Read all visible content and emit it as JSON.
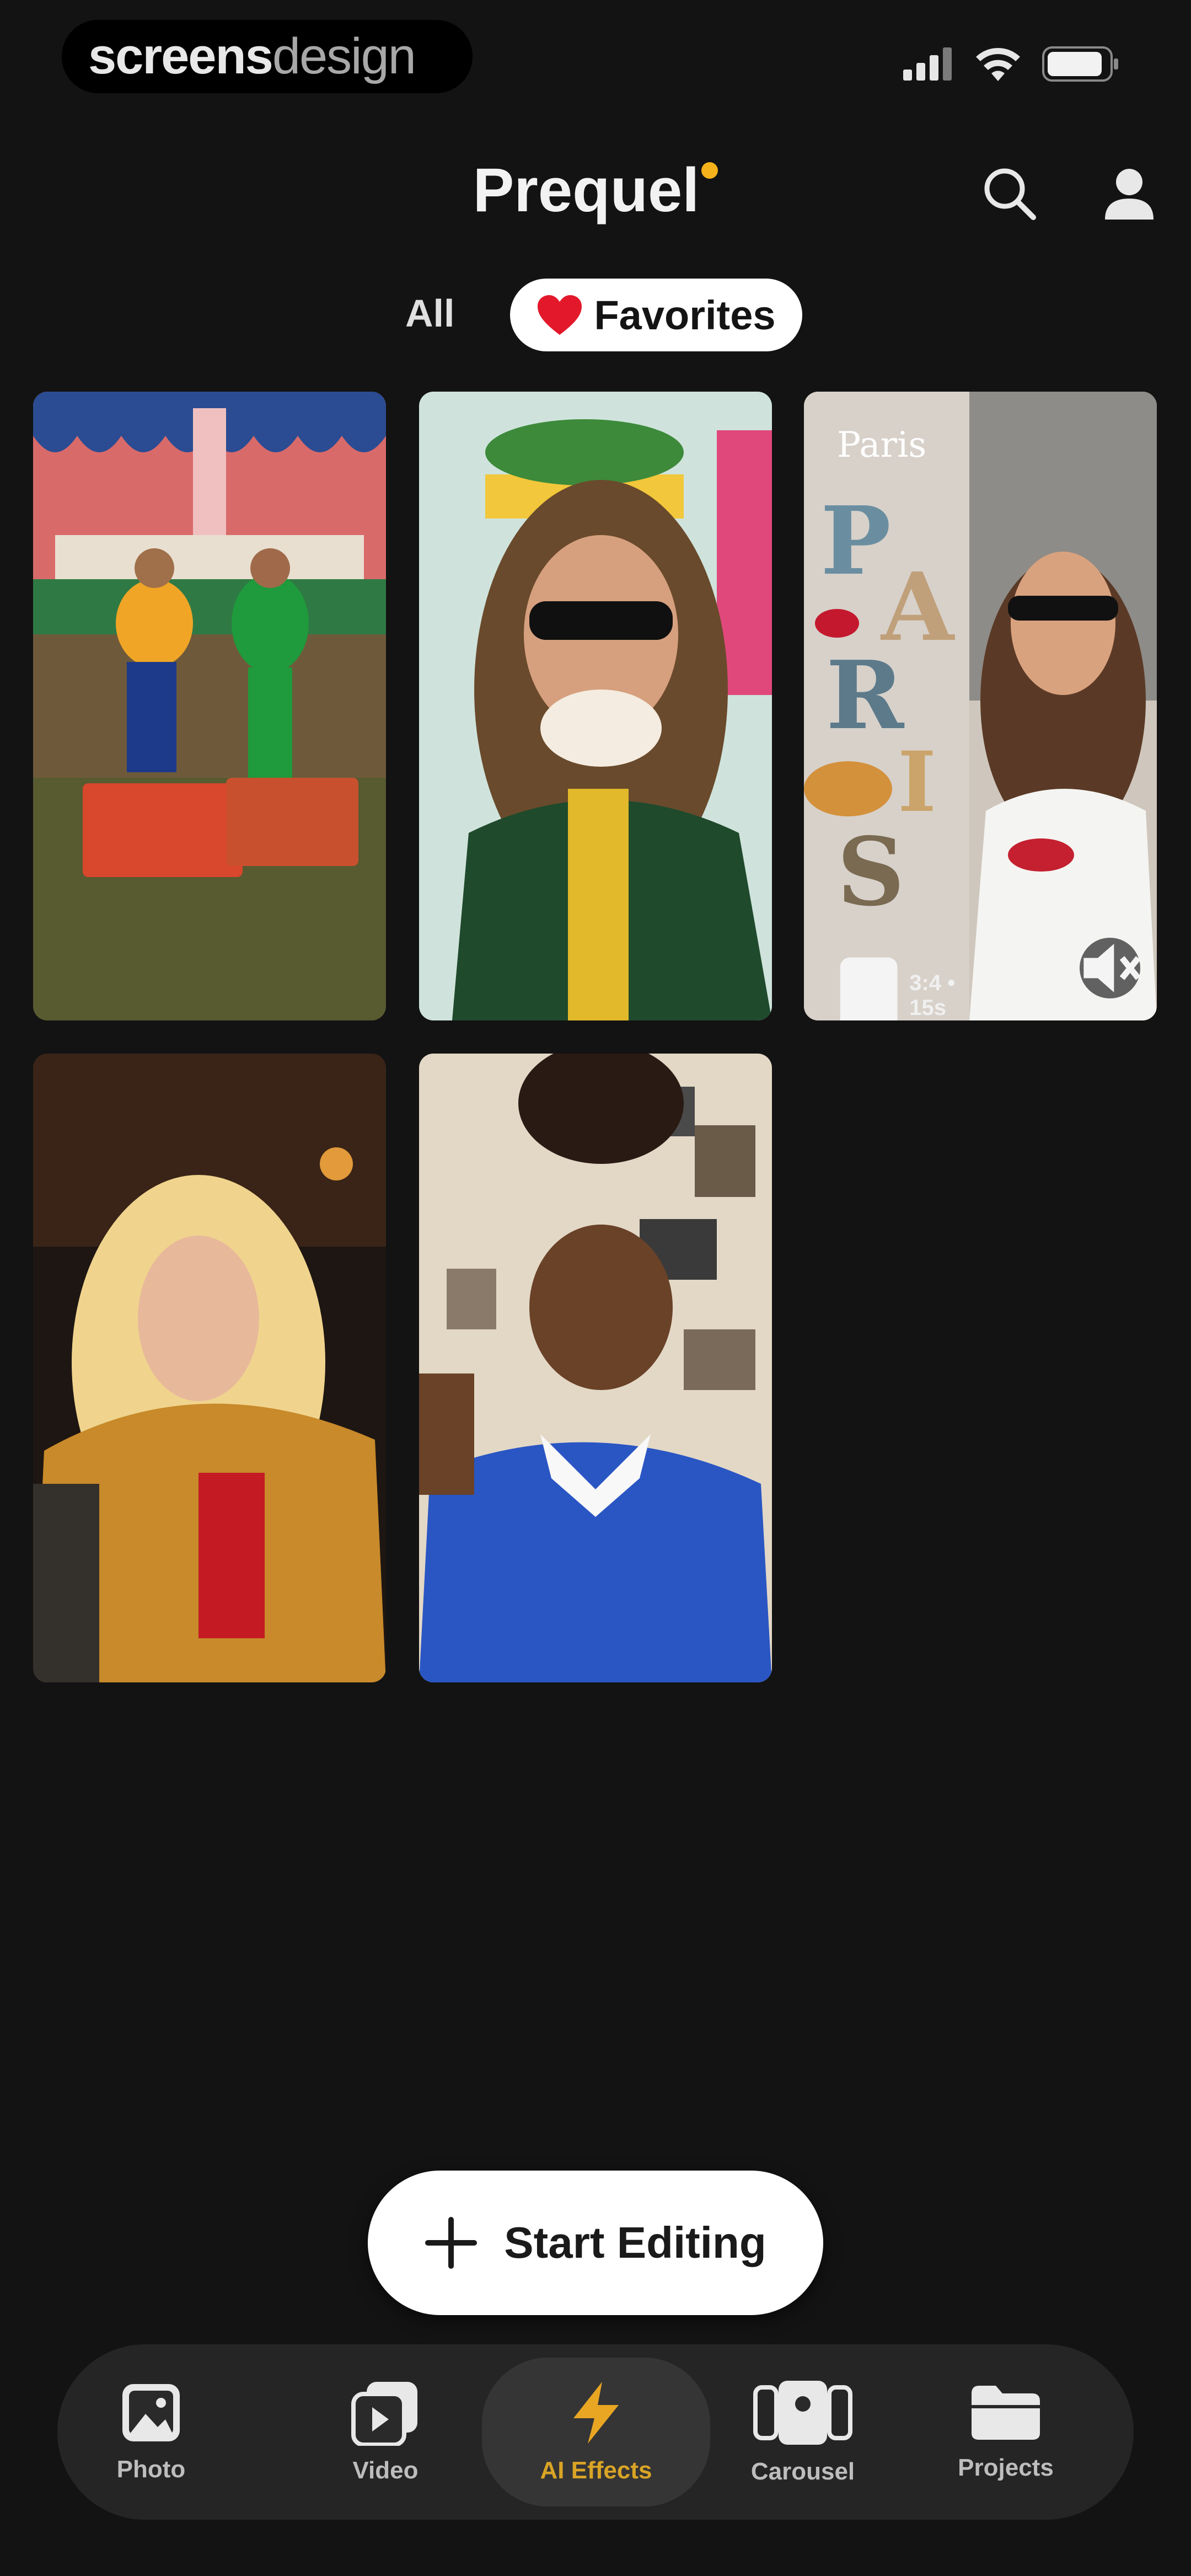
{
  "status_bar": {
    "brand_bold": "screens",
    "brand_light": "design"
  },
  "header": {
    "title": "Prequel",
    "accent_color": "#f5b21a"
  },
  "tabs": {
    "all_label": "All",
    "favorites_label": "Favorites",
    "favorites_icon": "heart-icon"
  },
  "grid": {
    "items": [
      {
        "kind": "photo"
      },
      {
        "kind": "photo"
      },
      {
        "kind": "video",
        "overlay_title": "Paris",
        "overlay_meta": "3:4 • 15s",
        "sound_icon": "mute-icon"
      },
      {
        "kind": "photo"
      },
      {
        "kind": "photo"
      }
    ]
  },
  "cta": {
    "label": "Start Editing",
    "icon": "plus-icon"
  },
  "bottom_nav": {
    "active_color": "#d9a426",
    "items": [
      {
        "label": "Photo",
        "icon": "photo-icon"
      },
      {
        "label": "Video",
        "icon": "video-icon"
      },
      {
        "label": "AI Effects",
        "icon": "lightning-icon",
        "active": true
      },
      {
        "label": "Carousel",
        "icon": "carousel-icon"
      },
      {
        "label": "Projects",
        "icon": "folder-icon"
      }
    ]
  }
}
